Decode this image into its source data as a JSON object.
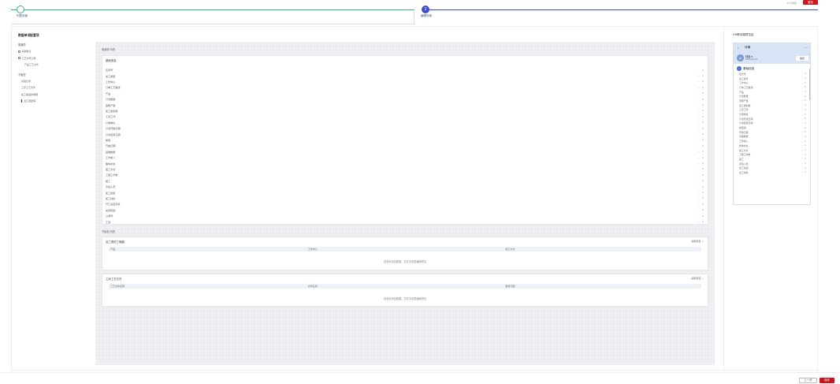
{
  "topbar": {
    "link_label": "示例值",
    "action_label": "重布"
  },
  "steps": [
    {
      "label": "列表页面",
      "number": ""
    },
    {
      "label": "编辑页面",
      "number": "2"
    }
  ],
  "sidebar": {
    "title": "数据单词配置项",
    "groups": [
      {
        "label": "普通项",
        "items": [
          {
            "label": "基础信息",
            "level": 0,
            "checkbox": true
          },
          {
            "label": "工艺文件记录",
            "level": 0,
            "checkbox": true
          },
          {
            "label": "产品工艺文件",
            "level": 1,
            "checkbox": false
          }
        ]
      },
      {
        "label": "子级型",
        "items": [
          {
            "label": "基础记录",
            "level": 1,
            "checkbox": false
          },
          {
            "label": "工序工艺文件",
            "level": 1,
            "checkbox": false
          },
          {
            "label": "加工精度的明细",
            "level": 1,
            "checkbox": false
          },
          {
            "label": "加工图纸库",
            "level": 1,
            "checkbox": false,
            "active": true
          }
        ]
      }
    ]
  },
  "canvas": {
    "basic_section_label": "普通项 列表",
    "basic_card_title": "基础信息",
    "fields": [
      "任务号",
      "加工类型",
      "工作中心",
      "订单工艺路线",
      "产品",
      "计划数量",
      "首刷产量",
      "加工类别组",
      "工序工作",
      "计量单位",
      "计划开始日期",
      "计划结束日期",
      "类型",
      "开始日期",
      "基础数量",
      "工作类入",
      "整体状态",
      "施工方式",
      "工程工作类",
      "报工",
      "评估人员",
      "加工班组",
      "加工材料",
      "开工后自然系",
      "关闭原因",
      "公用号",
      "工序"
    ],
    "field_ops": "— ⇅",
    "sub_section_label": "子级型 列表",
    "sub_cards": [
      {
        "title": "加工类的工明细",
        "edit_label": "编辑项目 >",
        "columns": [
          "产品",
          "工作中心",
          "施工方式"
        ],
        "empty_text": "您尚未添加数据，请在字段里编辑项目"
      },
      {
        "title": "工序工艺文件",
        "edit_label": "编辑项目 >",
        "columns": [
          "工艺文件名称",
          "文件名称",
          "更新日期"
        ],
        "empty_text": "您尚未添加数据，请在字段里编辑项目"
      }
    ]
  },
  "preview": {
    "title": "H5移动端预览区",
    "phone_title": "详情",
    "more": "···",
    "user_name": "林品 ▾",
    "user_sub": "2024-04-16",
    "user_action": "推送",
    "avatar_text": "林",
    "section_title": "基础信息",
    "section_icon": "i",
    "rows": [
      "任务号",
      "加工类号",
      "工作中心",
      "订单工艺路线",
      "产品",
      "计划数量",
      "首刷产量",
      "加工类别组",
      "工序工作",
      "计量单位",
      "计划开始日期",
      "计划结束日期",
      "类型组",
      "开始日期",
      "基础数量",
      "工作类入",
      "整体状态",
      "施工方式",
      "工程工作类",
      "报工",
      "评估人员",
      "加工班组",
      "加工材料"
    ],
    "row_ops": "— ⇅"
  },
  "bottom": {
    "prev_label": "上一步",
    "save_label": "保存"
  }
}
